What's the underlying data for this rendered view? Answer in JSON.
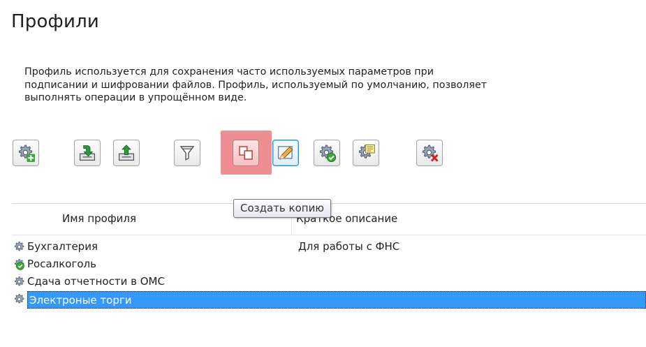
{
  "page": {
    "title": "Профили",
    "description_lines": [
      "Профиль используется для сохранения часто используемых параметров при",
      "подписании и шифровании файлов. Профиль, используемый по умолчанию, позволяет",
      "выполнять операции в упрощённом виде."
    ]
  },
  "toolbar": {
    "buttons": [
      {
        "name": "add-profile",
        "icon": "gear-plus-icon"
      },
      {
        "name": "import-profile",
        "icon": "import-icon"
      },
      {
        "name": "export-profile",
        "icon": "export-icon"
      },
      {
        "name": "filter-profiles",
        "icon": "filter-icon"
      },
      {
        "name": "copy-profile",
        "icon": "copy-icon",
        "state": "hovered"
      },
      {
        "name": "edit-profile",
        "icon": "edit-pencil-icon",
        "state": "active"
      },
      {
        "name": "set-default-profile",
        "icon": "gear-check-icon"
      },
      {
        "name": "profile-details",
        "icon": "gear-note-icon"
      },
      {
        "name": "delete-profile",
        "icon": "gear-delete-icon"
      }
    ],
    "tooltip": "Создать копию"
  },
  "table": {
    "columns": [
      "Имя профиля",
      "Краткое описание"
    ],
    "rows": [
      {
        "name": "Бухгалтерия",
        "description": "Для работы с ФНС",
        "icon": "gear-icon"
      },
      {
        "name": "Росалкоголь",
        "description": "",
        "icon": "gear-check-icon",
        "default": true
      },
      {
        "name": "Сдача отчетности в ОМС",
        "description": "",
        "icon": "gear-icon"
      },
      {
        "name": "Электроные торги",
        "description": "",
        "icon": "gear-icon",
        "selected": true
      }
    ]
  },
  "colors": {
    "selection": "#3399ff",
    "hover_highlight": "#ee8e93",
    "active_border": "#2b8bd1"
  }
}
